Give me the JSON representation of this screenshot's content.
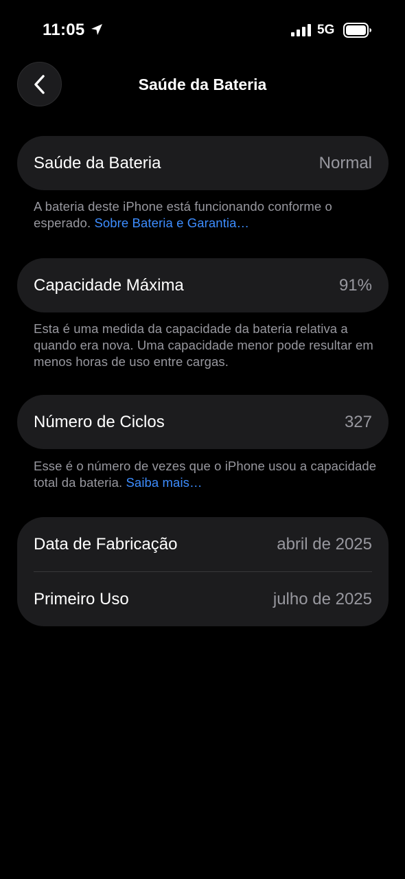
{
  "status_bar": {
    "time": "11:05",
    "network": "5G",
    "icons": [
      "location-arrow-icon",
      "cellular-signal-icon",
      "battery-icon"
    ]
  },
  "nav": {
    "title": "Saúde da Bateria",
    "back_icon": "chevron-left-icon"
  },
  "battery_health": {
    "label": "Saúde da Bateria",
    "value": "Normal",
    "footnote": "A bateria deste iPhone está funcionando conforme o esperado.",
    "link": "Sobre Bateria e Garantia…"
  },
  "max_capacity": {
    "label": "Capacidade Máxima",
    "value": "91%",
    "footnote": "Esta é uma medida da capacidade da bateria relativa a quando era nova. Uma capacidade menor pode resultar em menos horas de uso entre cargas."
  },
  "cycle_count": {
    "label": "Número de Ciclos",
    "value": "327",
    "footnote": "Esse é o número de vezes que o iPhone usou a capacidade total da bateria.",
    "link": "Saiba mais…"
  },
  "dates": {
    "manufacture_label": "Data de Fabricação",
    "manufacture_value": "abril de 2025",
    "first_use_label": "Primeiro Uso",
    "first_use_value": "julho de 2025"
  },
  "colors": {
    "background": "#000000",
    "card": "#1c1c1e",
    "secondary_text": "#98989f",
    "link": "#3d8dff",
    "separator": "#38383a"
  }
}
